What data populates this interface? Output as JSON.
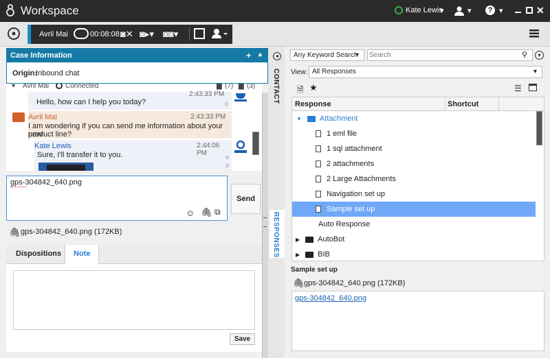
{
  "app": {
    "title": "Workspace"
  },
  "topbar": {
    "user_name": "Kate Lewis",
    "status_color": "#3cb043"
  },
  "callbar": {
    "contact": "Avril Mai",
    "timer": "00:08:08"
  },
  "case_info": {
    "title": "Case Information",
    "origin_label": "Origin:",
    "origin_value": "Inbound chat"
  },
  "chat": {
    "participant": "Avril Mai",
    "status": "Connected",
    "count_a": "(7)",
    "count_b": "(3)",
    "ts_top": "2:43:33 PM",
    "msg0_text": "Hello, how can I help you today?",
    "msg1_sender": "Avril Mai",
    "msg1_time": "2:43:33 PM",
    "msg1_text_l1": "I am wondering if you can send me information about your new",
    "msg1_text_l2": "product line?",
    "msg2_sender": "Kate Lewis",
    "msg2_time": "2:44:06 PM",
    "msg2_text": "Sure, I'll transfer it to you.",
    "status_ring": "o"
  },
  "compose": {
    "value": "gps-304842_640.png",
    "send_label": "Send"
  },
  "attachment": {
    "name": "gps-304842_640.png (172KB)"
  },
  "tabs": {
    "dispositions": "Dispositions",
    "note": "Note"
  },
  "note": {
    "save_label": "Save"
  },
  "side_tabs": {
    "contact": "CONTACT",
    "responses": "RESPONSES"
  },
  "responses": {
    "search_mode": "Any Keyword Search",
    "search_placeholder": "Search",
    "view_label": "View:",
    "view_value": "All Responses",
    "col_response": "Response",
    "col_shortcut": "Shortcut",
    "folder_open": "Attachment",
    "items": [
      "1 eml file",
      "1 sql attachment",
      "2 attachments",
      "2 Large Attachments",
      "Navigation set up",
      "Sample set up"
    ],
    "folders": [
      "Auto Response",
      "AutoBot",
      "BIB"
    ],
    "preview_title": "Sample set up",
    "preview_attachment": "gps-304842_640.png (172KB)",
    "preview_link": "gps-304842_640.png"
  }
}
